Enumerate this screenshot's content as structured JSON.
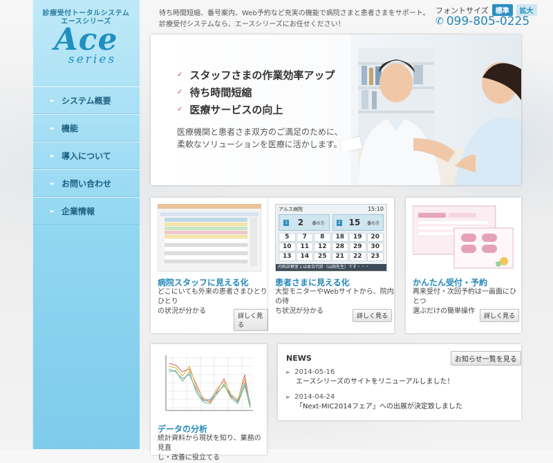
{
  "header": {
    "tagline_line1": "待ち時間短縮、番号案内、Web予約など充実の機能で病院さまと患者さまをサポート。",
    "tagline_line2": "診療受付システムなら、エースシリーズにお任せください！",
    "font_size_label": "フォントサイズ",
    "font_size_standard": "標準",
    "font_size_large": "拡大",
    "phone_icon": "phone-icon",
    "phone_number": "099-805-0225"
  },
  "logo": {
    "subtitle_line1": "診療受付トータルシステム",
    "subtitle_line2": "エースシリーズ",
    "name": "Ace",
    "series": "series"
  },
  "nav": {
    "items": [
      {
        "label": "システム概要"
      },
      {
        "label": "機能"
      },
      {
        "label": "導入について"
      },
      {
        "label": "お問い合わせ"
      },
      {
        "label": "企業情報"
      }
    ]
  },
  "hero": {
    "points": [
      "スタッフさまの作業効率アップ",
      "待ち時間短縮",
      "医療サービスの向上"
    ],
    "desc_line1": "医療機関と患者さま双方のご満足のために、",
    "desc_line2": "柔軟なソリューションを医療に活かします。"
  },
  "cards": [
    {
      "title": "病院スタッフに見える化",
      "text_line1": "どこにいても外来の患者さまひとりひとり",
      "text_line2": "の状況が分かる",
      "button": "詳しく見る"
    },
    {
      "title": "患者さまに見える化",
      "text_line1": "大型モニターやWebサイトから、院内の待",
      "text_line2": "ち状況が分かる",
      "button": "詳しく見る",
      "monitor": {
        "hospital": "アルス病院",
        "time": "15:10",
        "room1_label": "診察室",
        "room1_num": "1",
        "room1_call": "2",
        "room2_label": "診察室",
        "room2_num": "2",
        "room2_call": "15",
        "unit": "番の方",
        "numbers": [
          "5",
          "7",
          "8",
          "18",
          "19",
          "20",
          "10",
          "11",
          "12",
          "28",
          "29",
          "30",
          "13",
          "14",
          "25",
          "21",
          "22",
          "23"
        ],
        "ticker": "内科診察室１は本日代診（山田先生）です・・・"
      }
    },
    {
      "title": "かんたん受付・予約",
      "text_line1": "再来受付・次回予約は一画面にひとつ",
      "text_line2": "選ぶだけの簡単操作",
      "button": "詳しく見る"
    },
    {
      "title": "データの分析",
      "text_line1": "統計資料から現状を知り、業務の見直",
      "text_line2": "し・改善に役立てる"
    }
  ],
  "news": {
    "heading": "NEWS",
    "list_button": "お知らせ一覧を見る",
    "items": [
      {
        "date": "2014-05-16",
        "text": "エースシリーズのサイトをリニューアルしました！"
      },
      {
        "date": "2014-04-24",
        "text": "「Next-MIC2014フェア」への出展が決定致しました"
      }
    ]
  },
  "colors": {
    "accent": "#2487b8",
    "sidebar_top": "#bfe9f8",
    "sidebar_bottom": "#7fcbeb",
    "check": "#d24a4a"
  }
}
